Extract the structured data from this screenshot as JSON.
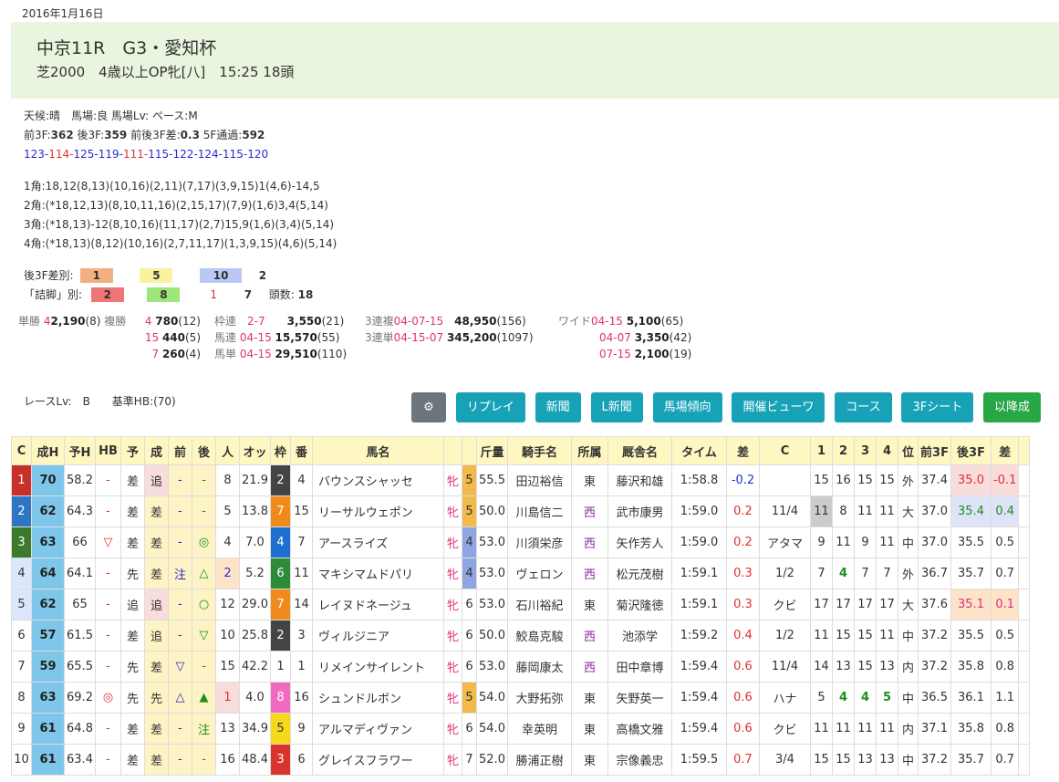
{
  "date": "2016年1月16日",
  "race": {
    "title": "中京11R　G3・愛知杯",
    "subtitle": "芝2000　4歳以上OP牝[八]　15:25 18頭"
  },
  "conditions": {
    "line1": "天候:晴　馬場:良 馬場Lv: ペース:M",
    "pace_a": "前3F:",
    "pace_a_val": "362",
    "pace_b": " 後3F:",
    "pace_b_val": "359",
    "pace_c": " 前後3F差:",
    "pace_c_val": "0.3",
    "pace_d": " 5F通過:",
    "pace_d_val": "592"
  },
  "laps": [
    "123",
    "114",
    "125",
    "119",
    "111",
    "115",
    "122",
    "124",
    "115",
    "120"
  ],
  "corners": [
    "1角:18,12(8,13)(10,16)(2,11)(7,17)(3,9,15)1(4,6)-14,5",
    "2角:(*18,12,13)(8,10,11,16)(2,15,17)(7,9)(1,6)3,4(5,14)",
    "3角:(*18,13)-12(8,10,16)(11,17)(2,7)15,9(1,6)(3,4)(5,14)",
    "4角:(*18,13)(8,12)(10,16)(2,7,11,17)(1,3,9,15)(4,6)(5,14)"
  ],
  "agari": {
    "label": "後3F差別:",
    "v1": "1",
    "v2": "5",
    "v3": "10",
    "v4": "2",
    "label2": "「詰脚」別:",
    "w1": "2",
    "w2": "8",
    "w3": "1",
    "w4": "7",
    "count_label": "頭数:",
    "count": "18"
  },
  "payouts": {
    "tansho_label": "単勝",
    "tansho_no": "4",
    "tansho_amt": "2,190",
    "tansho_pop": "(8)",
    "fukusho_label": "複勝",
    "fukusho": [
      {
        "no": "4",
        "amt": "780",
        "pop": "(12)"
      },
      {
        "no": "15",
        "amt": "440",
        "pop": "(5)"
      },
      {
        "no": "7",
        "amt": "260",
        "pop": "(4)"
      }
    ],
    "wakuren_label": "枠連",
    "wakuren_no": "2-7",
    "wakuren_amt": "3,550",
    "wakuren_pop": "(21)",
    "umaren_label": "馬連",
    "umaren_no": "04-15",
    "umaren_amt": "15,570",
    "umaren_pop": "(55)",
    "umatan_label": "馬単",
    "umatan_no": "04-15",
    "umatan_amt": "29,510",
    "umatan_pop": "(110)",
    "sanfuku_label": "3連複",
    "sanfuku_no": "04-07-15",
    "sanfuku_amt": "48,950",
    "sanfuku_pop": "(156)",
    "santan_label": "3連単",
    "santan_no": "04-15-07",
    "santan_amt": "345,200",
    "santan_pop": "(1097)",
    "wide_label": "ワイド",
    "wide": [
      {
        "no": "04-15",
        "amt": "5,100",
        "pop": "(65)"
      },
      {
        "no": "04-07",
        "amt": "3,350",
        "pop": "(42)"
      },
      {
        "no": "07-15",
        "amt": "2,100",
        "pop": "(19)"
      }
    ]
  },
  "race_level": "レースLv:　B　　基準HB:(70)",
  "buttons": {
    "gear": "⚙",
    "replay": "リプレイ",
    "news": "新聞",
    "lnews": "L新聞",
    "track": "馬場傾向",
    "viewer": "開催ビューワ",
    "course": "コース",
    "sheet3f": "3Fシート",
    "after": "以降成"
  },
  "headers": [
    "C",
    "成H",
    "予H",
    "HB",
    "予",
    "成",
    "前",
    "後",
    "人",
    "オッ",
    "枠",
    "番",
    "馬名",
    "",
    "",
    "斤量",
    "騎手名",
    "所属",
    "厩舎名",
    "タイム",
    "差",
    "C",
    "1",
    "2",
    "3",
    "4",
    "位",
    "前3F",
    "後3F",
    "差",
    ""
  ],
  "rows": [
    {
      "rank": "1",
      "h": "70",
      "yh": "58.2",
      "hb": "-",
      "yo": "差",
      "sei": "追",
      "mae": "-",
      "ato": "-",
      "pop": "8",
      "odds": "21.9",
      "waku": "2",
      "num": "4",
      "name": "バウンスシャッセ",
      "sex": "牝",
      "age": "5",
      "kin": "55.5",
      "jockey": "田辺裕信",
      "aff": "東",
      "trainer": "藤沢和雄",
      "time": "1:58.8",
      "diff": "-0.2",
      "c": "",
      "c1": "15",
      "c2": "16",
      "c3": "15",
      "c4": "15",
      "pos": "外",
      "f3": "37.4",
      "l3": "35.0",
      "d3": "-0.1"
    },
    {
      "rank": "2",
      "h": "62",
      "yh": "64.3",
      "hb": "-",
      "yo": "差",
      "sei": "差",
      "mae": "-",
      "ato": "-",
      "pop": "5",
      "odds": "13.8",
      "waku": "7",
      "num": "15",
      "name": "リーサルウェポン",
      "sex": "牝",
      "age": "5",
      "kin": "50.0",
      "jockey": "川島信二",
      "aff": "西",
      "trainer": "武市康男",
      "time": "1:59.0",
      "diff": "0.2",
      "c": "11/4",
      "c1": "11",
      "c2": "8",
      "c3": "11",
      "c4": "11",
      "pos": "大",
      "f3": "37.0",
      "l3": "35.4",
      "d3": "0.4"
    },
    {
      "rank": "3",
      "h": "63",
      "yh": "66",
      "hb": "▽",
      "yo": "差",
      "sei": "差",
      "mae": "-",
      "ato": "◎",
      "pop": "4",
      "odds": "7.0",
      "waku": "4",
      "num": "7",
      "name": "アースライズ",
      "sex": "牝",
      "age": "4",
      "kin": "53.0",
      "jockey": "川須栄彦",
      "aff": "西",
      "trainer": "矢作芳人",
      "time": "1:59.0",
      "diff": "0.2",
      "c": "アタマ",
      "c1": "9",
      "c2": "11",
      "c3": "9",
      "c4": "11",
      "pos": "中",
      "f3": "37.0",
      "l3": "35.5",
      "d3": "0.5"
    },
    {
      "rank": "4",
      "h": "64",
      "yh": "64.1",
      "hb": "-",
      "yo": "先",
      "sei": "差",
      "mae": "注",
      "ato": "△",
      "pop": "2",
      "odds": "5.2",
      "waku": "6",
      "num": "11",
      "name": "マキシマムドパリ",
      "sex": "牝",
      "age": "4",
      "kin": "53.0",
      "jockey": "ヴェロン",
      "aff": "西",
      "trainer": "松元茂樹",
      "time": "1:59.1",
      "diff": "0.3",
      "c": "1/2",
      "c1": "7",
      "c2": "4",
      "c3": "7",
      "c4": "7",
      "pos": "外",
      "f3": "36.7",
      "l3": "35.7",
      "d3": "0.7"
    },
    {
      "rank": "5",
      "h": "62",
      "yh": "65",
      "hb": "-",
      "yo": "追",
      "sei": "追",
      "mae": "-",
      "ato": "○",
      "pop": "12",
      "odds": "29.0",
      "waku": "7",
      "num": "14",
      "name": "レイヌドネージュ",
      "sex": "牝",
      "age": "6",
      "kin": "53.0",
      "jockey": "石川裕紀",
      "aff": "東",
      "trainer": "菊沢隆徳",
      "time": "1:59.1",
      "diff": "0.3",
      "c": "クビ",
      "c1": "17",
      "c2": "17",
      "c3": "17",
      "c4": "17",
      "pos": "大",
      "f3": "37.6",
      "l3": "35.1",
      "d3": "0.1"
    },
    {
      "rank": "6",
      "h": "57",
      "yh": "61.5",
      "hb": "-",
      "yo": "差",
      "sei": "追",
      "mae": "-",
      "ato": "▽",
      "pop": "10",
      "odds": "25.8",
      "waku": "2",
      "num": "3",
      "name": "ヴィルジニア",
      "sex": "牝",
      "age": "6",
      "kin": "50.0",
      "jockey": "鮫島克駿",
      "aff": "西",
      "trainer": "池添学",
      "time": "1:59.2",
      "diff": "0.4",
      "c": "1/2",
      "c1": "11",
      "c2": "15",
      "c3": "15",
      "c4": "11",
      "pos": "中",
      "f3": "37.2",
      "l3": "35.5",
      "d3": "0.5"
    },
    {
      "rank": "7",
      "h": "59",
      "yh": "65.5",
      "hb": "-",
      "yo": "先",
      "sei": "差",
      "mae": "▽",
      "ato": "-",
      "pop": "15",
      "odds": "42.2",
      "waku": "1",
      "num": "1",
      "name": "リメインサイレント",
      "sex": "牝",
      "age": "6",
      "kin": "53.0",
      "jockey": "藤岡康太",
      "aff": "西",
      "trainer": "田中章博",
      "time": "1:59.4",
      "diff": "0.6",
      "c": "11/4",
      "c1": "14",
      "c2": "13",
      "c3": "15",
      "c4": "13",
      "pos": "内",
      "f3": "37.2",
      "l3": "35.8",
      "d3": "0.8"
    },
    {
      "rank": "8",
      "h": "63",
      "yh": "69.2",
      "hb": "◎",
      "yo": "先",
      "sei": "先",
      "mae": "△",
      "ato": "▲",
      "pop": "1",
      "odds": "4.0",
      "waku": "8",
      "num": "16",
      "name": "シュンドルボン",
      "sex": "牝",
      "age": "5",
      "kin": "54.0",
      "jockey": "大野拓弥",
      "aff": "東",
      "trainer": "矢野英一",
      "time": "1:59.4",
      "diff": "0.6",
      "c": "ハナ",
      "c1": "5",
      "c2": "4",
      "c3": "4",
      "c4": "5",
      "pos": "中",
      "f3": "36.5",
      "l3": "36.1",
      "d3": "1.1"
    },
    {
      "rank": "9",
      "h": "61",
      "yh": "64.8",
      "hb": "-",
      "yo": "差",
      "sei": "差",
      "mae": "-",
      "ato": "注",
      "pop": "13",
      "odds": "34.9",
      "waku": "5",
      "num": "9",
      "name": "アルマディヴァン",
      "sex": "牝",
      "age": "6",
      "kin": "54.0",
      "jockey": "幸英明",
      "aff": "東",
      "trainer": "高橋文雅",
      "time": "1:59.4",
      "diff": "0.6",
      "c": "クビ",
      "c1": "11",
      "c2": "11",
      "c3": "11",
      "c4": "11",
      "pos": "内",
      "f3": "37.1",
      "l3": "35.8",
      "d3": "0.8"
    },
    {
      "rank": "10",
      "h": "61",
      "yh": "63.4",
      "hb": "-",
      "yo": "差",
      "sei": "差",
      "mae": "-",
      "ato": "-",
      "pop": "16",
      "odds": "48.4",
      "waku": "3",
      "num": "6",
      "name": "グレイスフラワー",
      "sex": "牝",
      "age": "7",
      "kin": "52.0",
      "jockey": "勝浦正樹",
      "aff": "東",
      "trainer": "宗像義忠",
      "time": "1:59.5",
      "diff": "0.7",
      "c": "3/4",
      "c1": "15",
      "c2": "15",
      "c3": "13",
      "c4": "13",
      "pos": "中",
      "f3": "37.2",
      "l3": "35.7",
      "d3": "0.7"
    }
  ]
}
